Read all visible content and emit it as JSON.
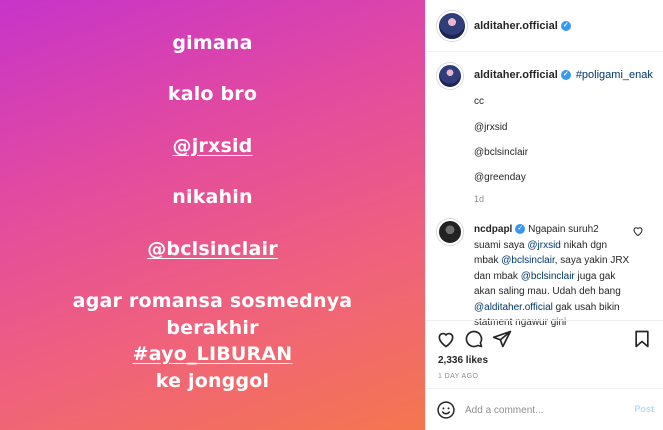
{
  "media": {
    "lines": [
      {
        "text": "gimana"
      },
      {
        "text": "kalo bro"
      },
      {
        "text": "@jrxsid"
      },
      {
        "text": "nikahin"
      },
      {
        "text": "@bclsinclair"
      },
      {
        "text": "agar romansa sosmednya"
      },
      {
        "text": "berakhir"
      },
      {
        "text": "#ayo_LIBURAN"
      },
      {
        "text": "ke jonggol"
      }
    ]
  },
  "header": {
    "username": "alditaher.official"
  },
  "caption": {
    "username": "alditaher.official",
    "hashtag": "#poligami_enak",
    "cc": "cc",
    "mentions": [
      "@jrxsid",
      "@bclsinclair",
      "@greenday"
    ],
    "age": "1d"
  },
  "comment": {
    "username": "ncdpapl",
    "lines": [
      {
        "parts": [
          {
            "t": "Ngapain suruh2",
            "link": false
          }
        ]
      },
      {
        "parts": [
          {
            "t": "suami saya ",
            "link": false
          },
          {
            "t": "@jrxsid",
            "link": true
          },
          {
            "t": " nikah dgn",
            "link": false
          }
        ]
      },
      {
        "parts": [
          {
            "t": "mbak ",
            "link": false
          },
          {
            "t": "@bclsinclair",
            "link": true
          },
          {
            "t": ", saya yakin JRX",
            "link": false
          }
        ]
      },
      {
        "parts": [
          {
            "t": "dan mbak ",
            "link": false
          },
          {
            "t": "@bclsinclair",
            "link": true
          },
          {
            "t": " juga gak",
            "link": false
          }
        ]
      },
      {
        "parts": [
          {
            "t": "akan saling mau. Udah deh bang",
            "link": false
          }
        ]
      },
      {
        "parts": [
          {
            "t": "@alditaher.official",
            "link": true
          },
          {
            "t": " gak usah bikin",
            "link": false
          }
        ]
      },
      {
        "parts": [
          {
            "t": "statment ngawur gini",
            "link": false
          }
        ]
      }
    ]
  },
  "stats": {
    "likes": "2,336 likes",
    "age": "1 DAY AGO"
  },
  "composer": {
    "placeholder": "Add a comment...",
    "post_label": "Post"
  }
}
